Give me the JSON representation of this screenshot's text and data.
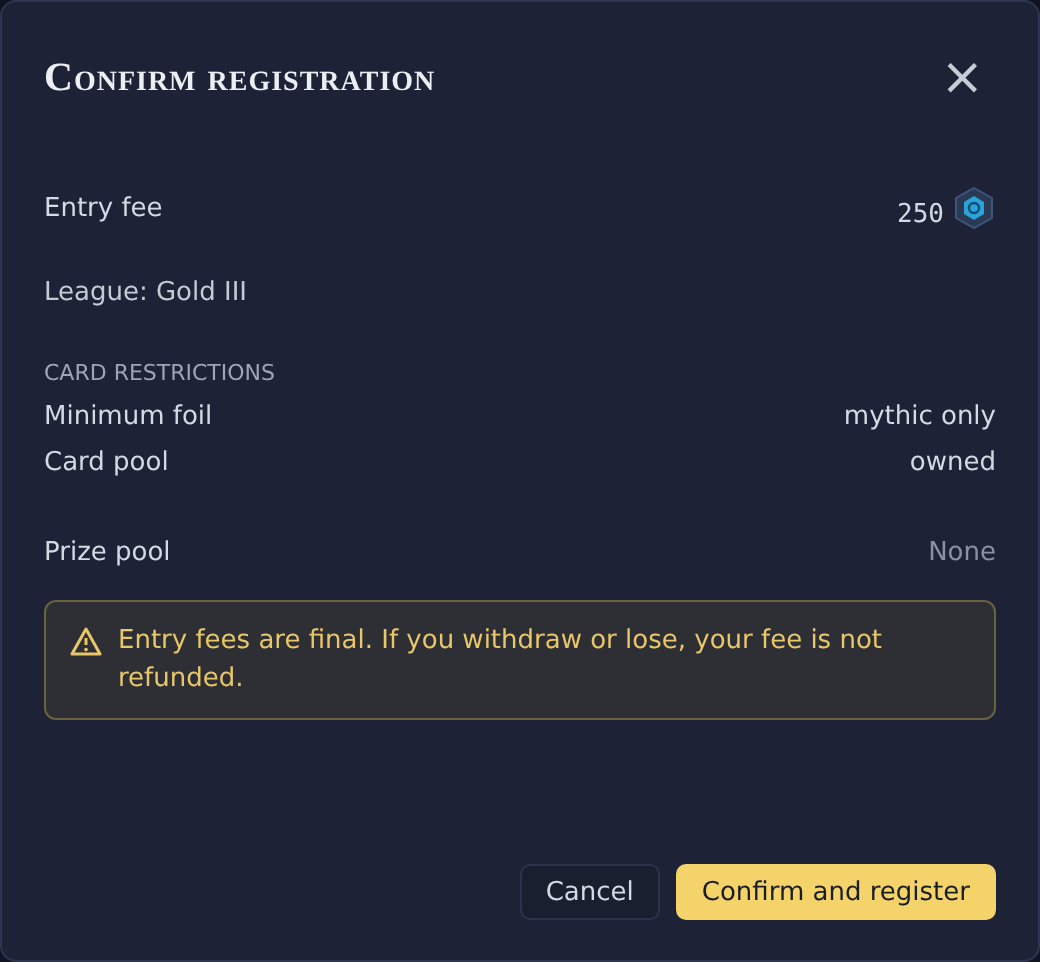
{
  "dialog": {
    "title": "Confirm registration",
    "close_label": "×"
  },
  "entry_fee": {
    "label": "Entry fee",
    "amount": "250"
  },
  "league": "League: Gold III",
  "card_restrictions": {
    "heading": "CARD RESTRICTIONS",
    "rows": [
      {
        "label": "Minimum foil",
        "value": "mythic only"
      },
      {
        "label": "Card pool",
        "value": "owned"
      }
    ]
  },
  "prize_pool": {
    "label": "Prize pool",
    "value": "None"
  },
  "warning": "Entry fees are final. If you withdraw or lose, your fee is not refunded.",
  "buttons": [
    {
      "label": "Cancel",
      "kind": "secondary"
    },
    {
      "label": "Confirm and register",
      "kind": "primary"
    }
  ]
}
